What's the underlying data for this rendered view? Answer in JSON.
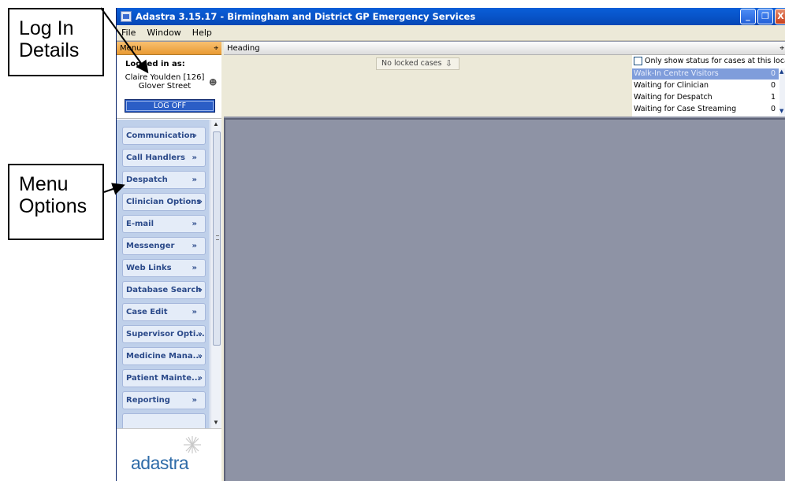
{
  "annotations": {
    "login": [
      "Log In",
      "Details"
    ],
    "menu": [
      "Menu",
      "Options"
    ]
  },
  "window": {
    "title": "Adastra 3.15.17 - Birmingham and District GP Emergency Services",
    "minimize": "_",
    "restore": "❐",
    "close": "X"
  },
  "menubar": [
    "File",
    "Window",
    "Help"
  ],
  "menu_panel": {
    "header": "Menu",
    "logged_in_label": "Logged in as:",
    "user_name": "Claire Youlden [126]",
    "user_location": "Glover Street",
    "logoff_label": "LOG OFF",
    "items": [
      "Communication",
      "Call Handlers",
      "Despatch",
      "Clinician Options",
      "E-mail",
      "Messenger",
      "Web Links",
      "Database Search",
      "Case Edit",
      "Supervisor Opti...",
      "Medicine Mana...",
      "Patient Mainte...",
      "Reporting"
    ],
    "logo_text": "adastra"
  },
  "heading_panel": {
    "header": "Heading",
    "locked_cases": "No locked cases",
    "status_filter_label": "Only show status for cases at this location",
    "status_rows": [
      {
        "label": "Walk-In Centre Visitors",
        "count": "0"
      },
      {
        "label": "Waiting for Clinician",
        "count": "0"
      },
      {
        "label": "Waiting for Despatch",
        "count": "1"
      },
      {
        "label": "Waiting for Case Streaming",
        "count": "0"
      }
    ]
  }
}
